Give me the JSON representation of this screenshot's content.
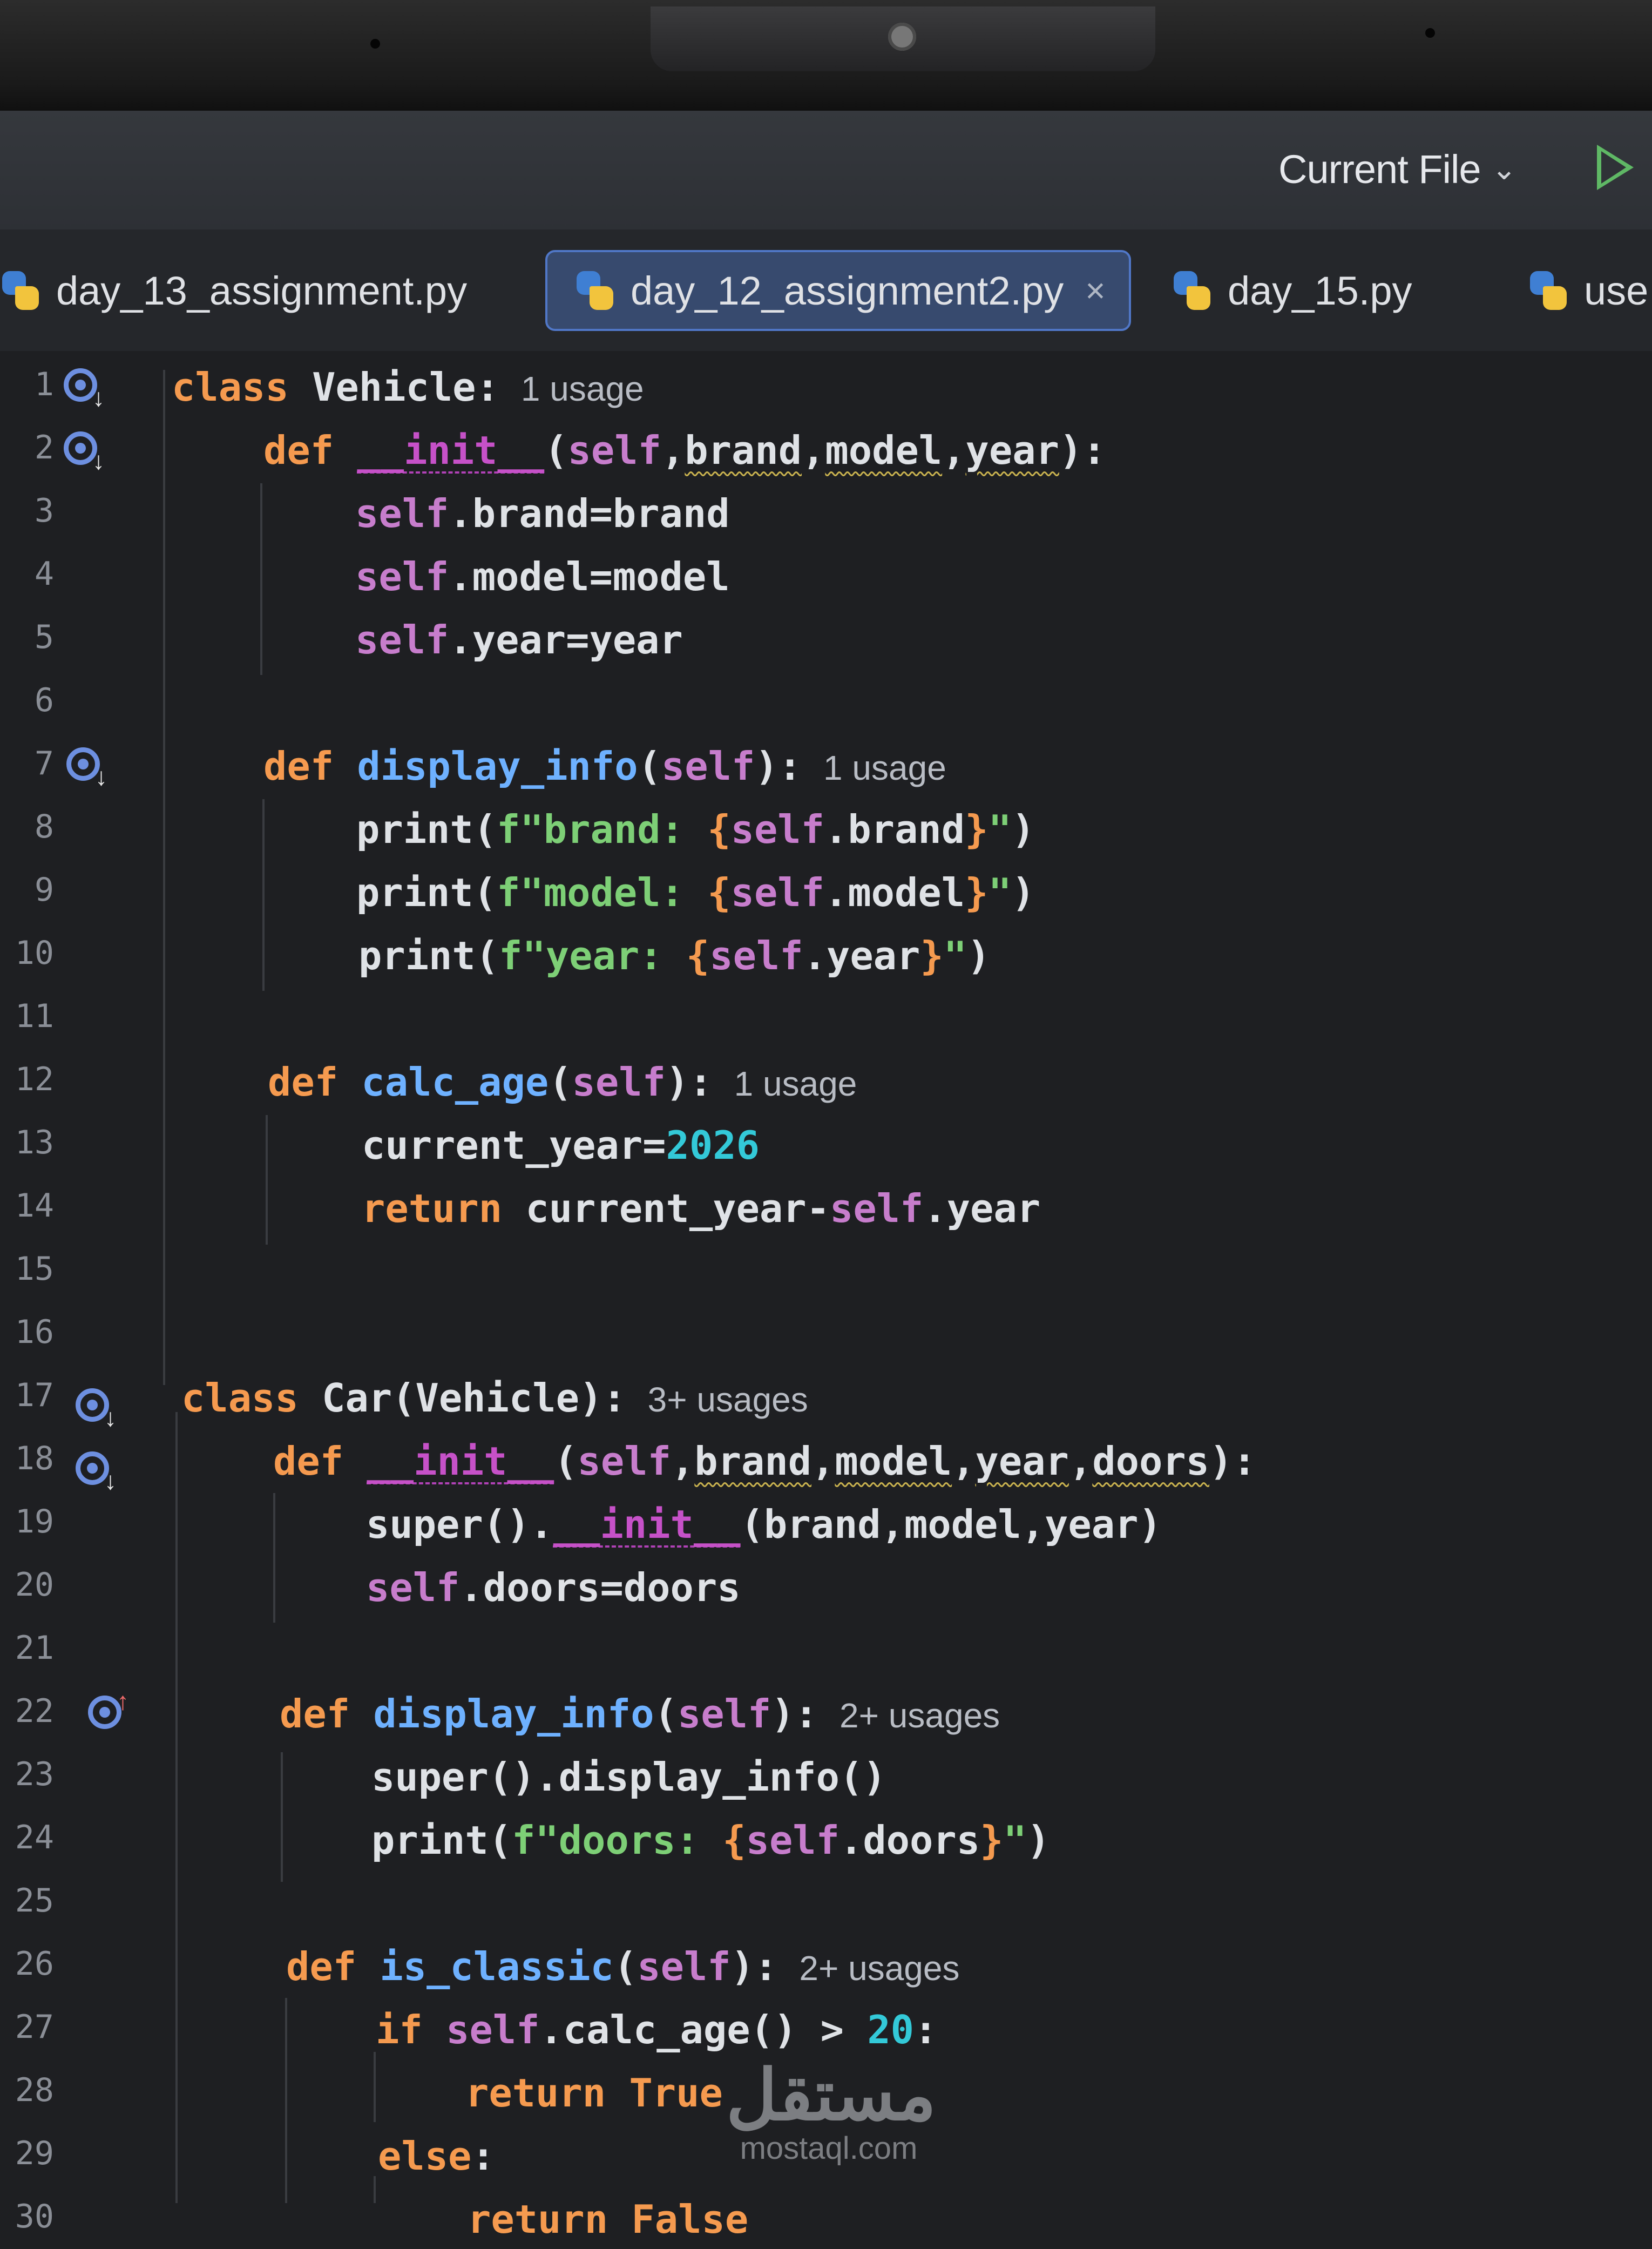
{
  "toolbar": {
    "run_configuration": "Current File",
    "chevron_icon": "chevron-down-icon",
    "run_icon": "play-icon"
  },
  "tabs": [
    {
      "label": "day_13_assignment.py",
      "active": false
    },
    {
      "label": "day_12_assignment2.py",
      "active": true,
      "close": "×"
    },
    {
      "label": "day_15.py",
      "active": false
    },
    {
      "label": "use",
      "active": false
    }
  ],
  "editor": {
    "line_numbers": [
      "1",
      "2",
      "3",
      "4",
      "5",
      "6",
      "7",
      "8",
      "9",
      "10",
      "11",
      "12",
      "13",
      "14",
      "15",
      "16",
      "17",
      "18",
      "19",
      "20",
      "21",
      "22",
      "23",
      "24",
      "25",
      "26",
      "27",
      "28",
      "29",
      "30"
    ],
    "hints": {
      "l1": "1 usage",
      "l7": "1 usage",
      "l12": "1 usage",
      "l17": "3+ usages",
      "l22": "2+ usages",
      "l26": "2+ usages"
    },
    "literals": {
      "current_year": "2026",
      "age_threshold": "20"
    }
  },
  "watermark": {
    "arabic": "مستقل",
    "site": "mostaql.com"
  },
  "colors": {
    "background": "#1e1f22",
    "keyword": "#f59a4f",
    "function": "#6eb1ff",
    "self": "#c77dcc",
    "string": "#7dcf76",
    "number": "#33c9d8",
    "tab_active": "#374a6e"
  }
}
